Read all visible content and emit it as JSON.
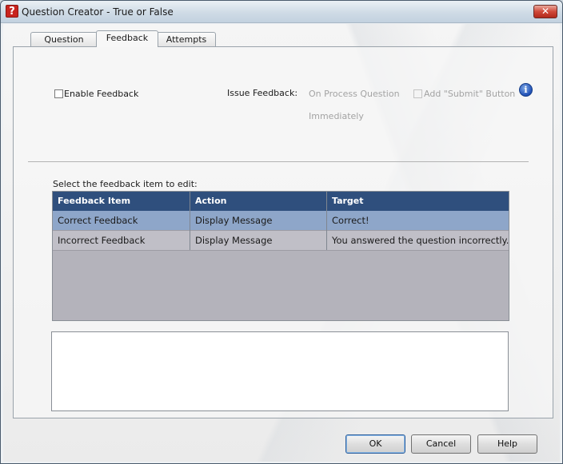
{
  "window": {
    "title": "Question Creator - True or False",
    "close_glyph": "✕",
    "app_icon_glyph": "?"
  },
  "tabs": [
    {
      "label": "Question",
      "active": false
    },
    {
      "label": "Feedback",
      "active": true
    },
    {
      "label": "Attempts",
      "active": false
    }
  ],
  "feedback": {
    "enable_label": "Enable Feedback",
    "enable_checked": false,
    "issue_label": "Issue Feedback:",
    "option_process": "On Process Question",
    "option_immediately": "Immediately",
    "submit_label": "Add \"Submit\" Button",
    "info_glyph": "i"
  },
  "table": {
    "caption": "Select the feedback item to edit:",
    "columns": [
      "Feedback Item",
      "Action",
      "Target"
    ],
    "rows": [
      {
        "item": "Correct Feedback",
        "action": "Display Message",
        "target": "Correct!",
        "selected": true
      },
      {
        "item": "Incorrect Feedback",
        "action": "Display Message",
        "target": "You answered the question incorrectly.",
        "selected": false
      }
    ]
  },
  "buttons": {
    "ok": "OK",
    "cancel": "Cancel",
    "help": "Help"
  },
  "colors": {
    "header": "#2f4f7d",
    "selected_row": "#8ea6c9",
    "table_bg": "#b4b3bb"
  }
}
